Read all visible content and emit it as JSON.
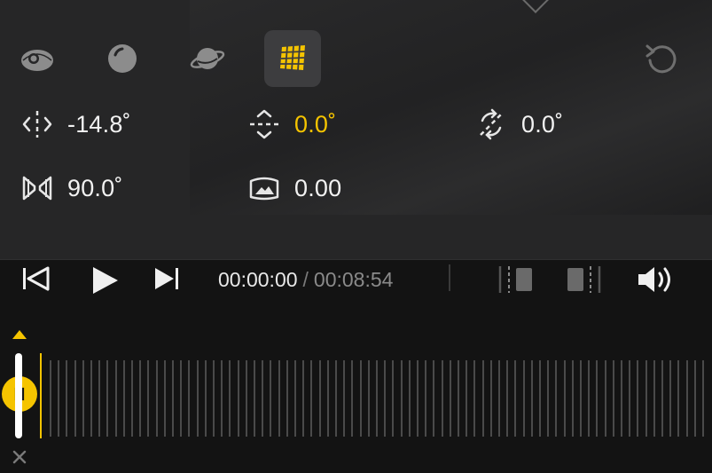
{
  "params": {
    "yaw": "-14.8˚",
    "pitch": "0.0˚",
    "roll": "0.0˚",
    "fov": "90.0˚",
    "distortion": "0.00"
  },
  "player": {
    "current_time": "00:00:00",
    "separator": "/",
    "total_time": "00:08:54"
  },
  "view_modes": [
    {
      "icon": "fisheye-icon",
      "active": false
    },
    {
      "icon": "sphere-icon",
      "active": false
    },
    {
      "icon": "planet-icon",
      "active": false
    },
    {
      "icon": "perspective-grid-icon",
      "active": true
    }
  ],
  "colors": {
    "accent": "#f5c400",
    "panel": "#262627",
    "background": "#131313"
  }
}
